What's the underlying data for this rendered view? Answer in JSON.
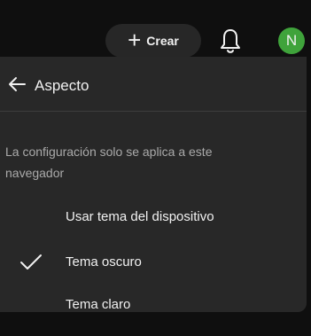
{
  "topbar": {
    "create_label": "Crear",
    "create_icon": "plus-icon",
    "notifications_icon": "bell-icon",
    "avatar_letter": "N",
    "avatar_color": "#3fa33b"
  },
  "menu": {
    "back_icon": "arrow-left-icon",
    "title": "Aspecto",
    "description": "La configuración solo se aplica a este navegador",
    "options": [
      {
        "label": "Usar tema del dispositivo",
        "selected": false
      },
      {
        "label": "Tema oscuro",
        "selected": true
      },
      {
        "label": "Tema claro",
        "selected": false
      }
    ]
  }
}
